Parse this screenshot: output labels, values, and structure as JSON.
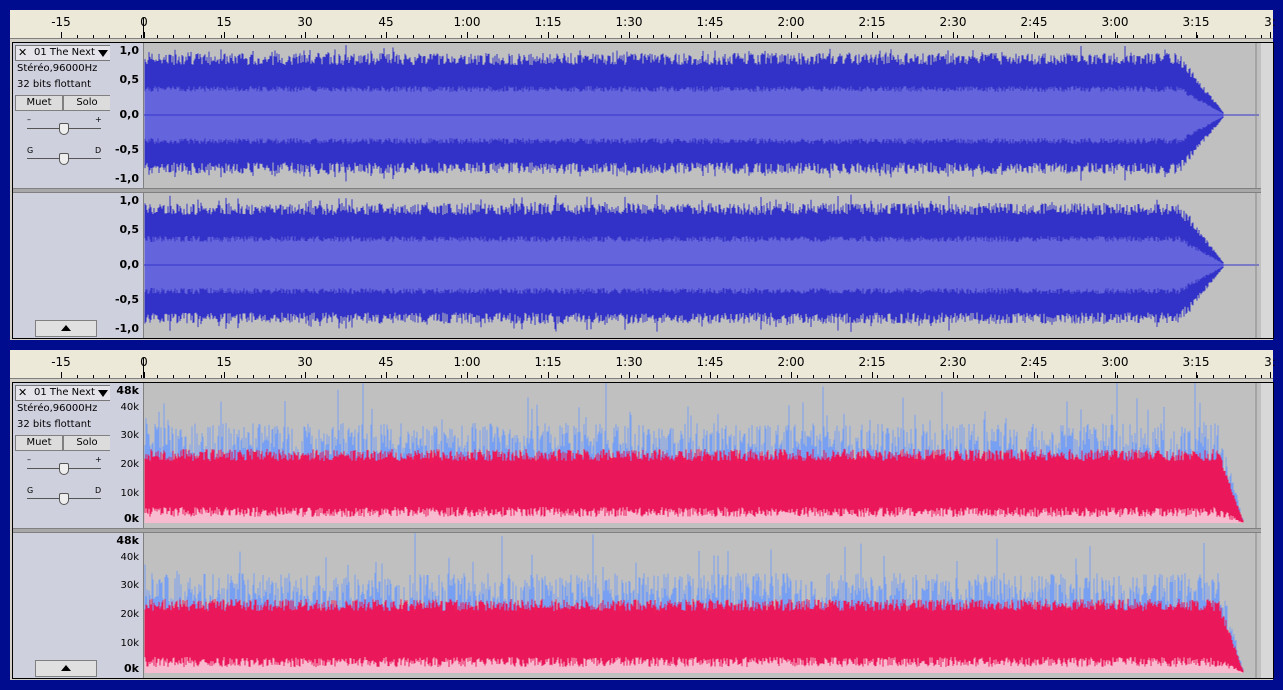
{
  "ruler": {
    "ticks": [
      "-15",
      "0",
      "15",
      "30",
      "45",
      "1:00",
      "1:15",
      "1:30",
      "1:45",
      "2:00",
      "2:15",
      "2:30",
      "2:45",
      "3:00",
      "3:15",
      "3:"
    ]
  },
  "tracks": [
    {
      "name": "01 The Next",
      "format": "Stéréo,96000Hz",
      "bits": "32 bits flottant",
      "mute_label": "Muet",
      "solo_label": "Solo",
      "gain_minus": "–",
      "gain_plus": "+",
      "pan_left": "G",
      "pan_right": "D",
      "view": "waveform",
      "scale": [
        "1,0",
        "0,5",
        "0,0",
        "-0,5",
        "-1,0"
      ],
      "colors": {
        "outer": "#3232c8",
        "inner": "#6464dc",
        "bg": "#c0c0c0"
      }
    },
    {
      "name": "01 The Next",
      "format": "Stéréo,96000Hz",
      "bits": "32 bits flottant",
      "mute_label": "Muet",
      "solo_label": "Solo",
      "gain_minus": "–",
      "gain_plus": "+",
      "pan_left": "G",
      "pan_right": "D",
      "view": "spectrogram",
      "scale": [
        "48k",
        "40k",
        "30k",
        "20k",
        "10k",
        "0k"
      ],
      "colors": {
        "low": "#ffffff",
        "mid": "#ff0040",
        "high": "#6699ff",
        "bg": "#c0c0c0"
      }
    }
  ]
}
